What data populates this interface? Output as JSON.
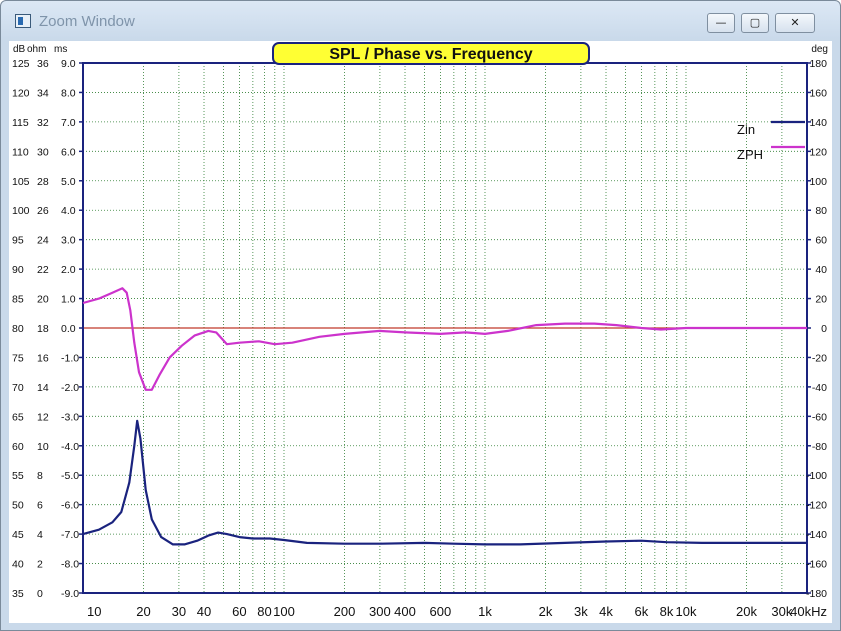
{
  "window": {
    "title": "Zoom Window",
    "controls": {
      "minimize": "—",
      "maximize": "▢",
      "close": "✕"
    }
  },
  "chart_data": {
    "type": "line",
    "title": "SPL / Phase vs. Frequency",
    "x_scale": "log",
    "xlim": [
      10,
      40000
    ],
    "x_tick_labels": [
      {
        "f": 10,
        "label": "10"
      },
      {
        "f": 20,
        "label": "20"
      },
      {
        "f": 30,
        "label": "30"
      },
      {
        "f": 40,
        "label": "40"
      },
      {
        "f": 60,
        "label": "60"
      },
      {
        "f": 80,
        "label": "80"
      },
      {
        "f": 100,
        "label": "100"
      },
      {
        "f": 200,
        "label": "200"
      },
      {
        "f": 300,
        "label": "300"
      },
      {
        "f": 400,
        "label": "400"
      },
      {
        "f": 600,
        "label": "600"
      },
      {
        "f": 1000,
        "label": "1k"
      },
      {
        "f": 2000,
        "label": "2k"
      },
      {
        "f": 3000,
        "label": "3k"
      },
      {
        "f": 4000,
        "label": "4k"
      },
      {
        "f": 6000,
        "label": "6k"
      },
      {
        "f": 8000,
        "label": "8k"
      },
      {
        "f": 10000,
        "label": "10k"
      },
      {
        "f": 20000,
        "label": "20k"
      },
      {
        "f": 30000,
        "label": "30k"
      },
      {
        "f": 40000,
        "label": "40kHz"
      }
    ],
    "left_axes": {
      "units": [
        "dB",
        "ohm",
        "ms"
      ],
      "dB": [
        "125",
        "120",
        "115",
        "110",
        "105",
        "100",
        "95",
        "90",
        "85",
        "80",
        "75",
        "70",
        "65",
        "60",
        "55",
        "50",
        "45",
        "40",
        "35"
      ],
      "ohm": [
        "36",
        "34",
        "32",
        "30",
        "28",
        "26",
        "24",
        "22",
        "20",
        "18",
        "16",
        "14",
        "12",
        "10",
        "8",
        "6",
        "4",
        "2",
        "0"
      ],
      "ms": [
        "9.0",
        "8.0",
        "7.0",
        "6.0",
        "5.0",
        "4.0",
        "3.0",
        "2.0",
        "1.0",
        "0.0",
        "-1.0",
        "-2.0",
        "-3.0",
        "-4.0",
        "-5.0",
        "-6.0",
        "-7.0",
        "-8.0",
        "-9.0"
      ]
    },
    "right_axis": {
      "unit": "deg",
      "ylim": [
        -180,
        180
      ],
      "labels": [
        "180",
        "160",
        "140",
        "120",
        "100",
        "80",
        "60",
        "40",
        "20",
        "0",
        "-20",
        "-40",
        "-60",
        "-80",
        "-100",
        "-120",
        "-140",
        "-160",
        "-180"
      ]
    },
    "grid": true,
    "legend_position": "top-right",
    "reference_line": {
      "deg": 0,
      "color": "#c0392b"
    },
    "series": [
      {
        "name": "Zin",
        "axis": "ohm",
        "color": "#1a237e",
        "points": [
          [
            10,
            4.0
          ],
          [
            12,
            4.3
          ],
          [
            14,
            4.8
          ],
          [
            15.5,
            5.5
          ],
          [
            17,
            7.5
          ],
          [
            18,
            10
          ],
          [
            18.6,
            11.7
          ],
          [
            19.3,
            10.5
          ],
          [
            20.5,
            7.0
          ],
          [
            22,
            5.0
          ],
          [
            24.5,
            3.8
          ],
          [
            28,
            3.3
          ],
          [
            32,
            3.3
          ],
          [
            37,
            3.55
          ],
          [
            42,
            3.9
          ],
          [
            47,
            4.1
          ],
          [
            52,
            4.0
          ],
          [
            60,
            3.8
          ],
          [
            70,
            3.7
          ],
          [
            85,
            3.7
          ],
          [
            100,
            3.6
          ],
          [
            130,
            3.4
          ],
          [
            200,
            3.35
          ],
          [
            300,
            3.35
          ],
          [
            500,
            3.4
          ],
          [
            700,
            3.35
          ],
          [
            1000,
            3.3
          ],
          [
            1500,
            3.3
          ],
          [
            2500,
            3.4
          ],
          [
            4000,
            3.5
          ],
          [
            6000,
            3.55
          ],
          [
            8000,
            3.45
          ],
          [
            12000,
            3.4
          ],
          [
            20000,
            3.4
          ],
          [
            40000,
            3.4
          ]
        ]
      },
      {
        "name": "ZPH",
        "axis": "deg",
        "color": "#cc33cc",
        "points": [
          [
            10,
            17
          ],
          [
            12,
            20
          ],
          [
            14,
            24
          ],
          [
            15.7,
            27
          ],
          [
            16.5,
            24
          ],
          [
            17.2,
            12
          ],
          [
            18,
            -10
          ],
          [
            19,
            -30
          ],
          [
            20.5,
            -42
          ],
          [
            22,
            -42
          ],
          [
            24,
            -32
          ],
          [
            27,
            -20
          ],
          [
            31,
            -12
          ],
          [
            36,
            -5
          ],
          [
            42,
            -2
          ],
          [
            46,
            -3
          ],
          [
            52,
            -11
          ],
          [
            60,
            -10
          ],
          [
            75,
            -9
          ],
          [
            90,
            -11
          ],
          [
            110,
            -10
          ],
          [
            150,
            -6
          ],
          [
            200,
            -4
          ],
          [
            300,
            -2
          ],
          [
            400,
            -3
          ],
          [
            600,
            -4
          ],
          [
            800,
            -3
          ],
          [
            1000,
            -4
          ],
          [
            1300,
            -2
          ],
          [
            1800,
            2
          ],
          [
            2500,
            3
          ],
          [
            3500,
            3
          ],
          [
            4500,
            2
          ],
          [
            6000,
            0
          ],
          [
            7500,
            -1
          ],
          [
            10000,
            0
          ],
          [
            15000,
            0
          ],
          [
            25000,
            0
          ],
          [
            40000,
            0
          ]
        ]
      }
    ]
  }
}
